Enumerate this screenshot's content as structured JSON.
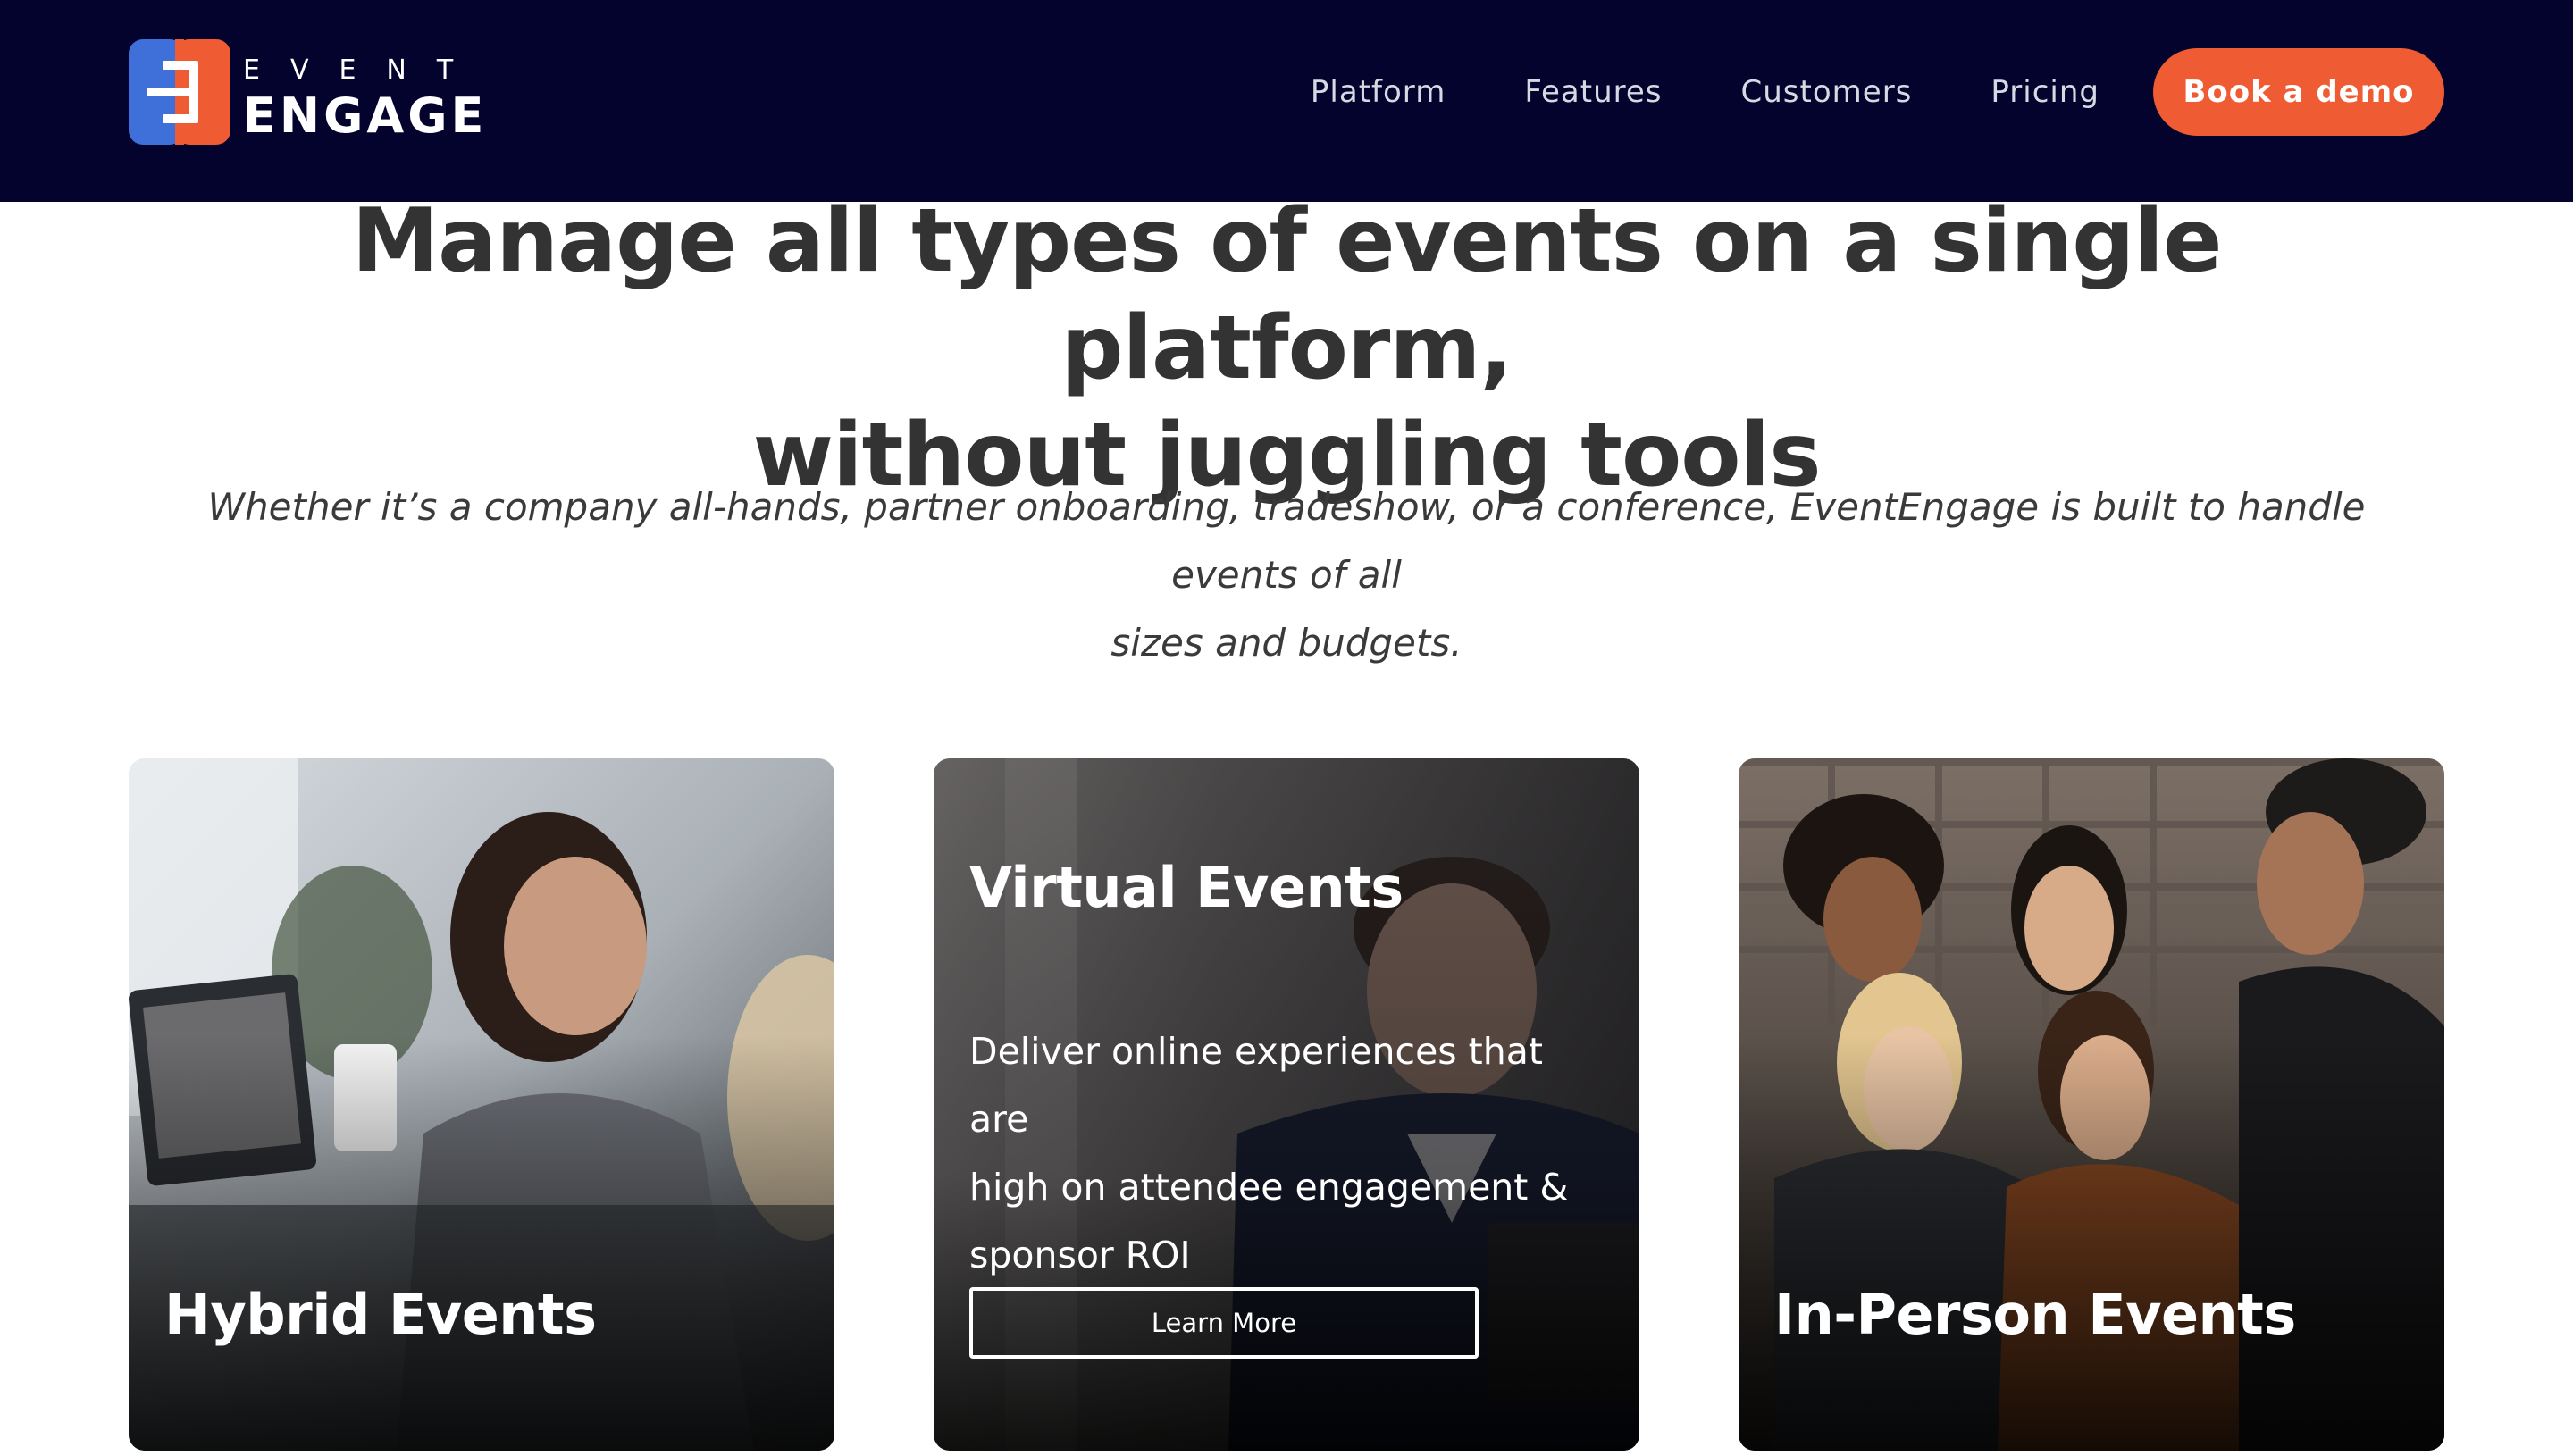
{
  "brand": {
    "logo_top": "EVENT",
    "logo_bottom": "ENGAGE",
    "colors": {
      "header_bg": "#03032e",
      "accent": "#ef5b32",
      "logo_blue": "#3f6fd8",
      "heading": "#333333"
    }
  },
  "nav": {
    "items": [
      {
        "label": "Platform"
      },
      {
        "label": "Features"
      },
      {
        "label": "Customers"
      },
      {
        "label": "Pricing"
      }
    ],
    "cta_label": "Book a demo"
  },
  "hero": {
    "headline_line1": "Manage all types of events on a single platform,",
    "headline_line2": "without juggling tools",
    "subtext_line1": "Whether it’s a company all-hands, partner onboarding, tradeshow, or a conference, EventEngage is built to handle events of all",
    "subtext_line2": "sizes and budgets."
  },
  "cards": [
    {
      "title": "Hybrid Events"
    },
    {
      "title": "Virtual Events",
      "desc_line1": "Deliver online experiences that are",
      "desc_line2": "high on attendee engagement &",
      "desc_line3": "sponsor ROI",
      "button": "Learn More"
    },
    {
      "title": "In-Person Events"
    }
  ]
}
